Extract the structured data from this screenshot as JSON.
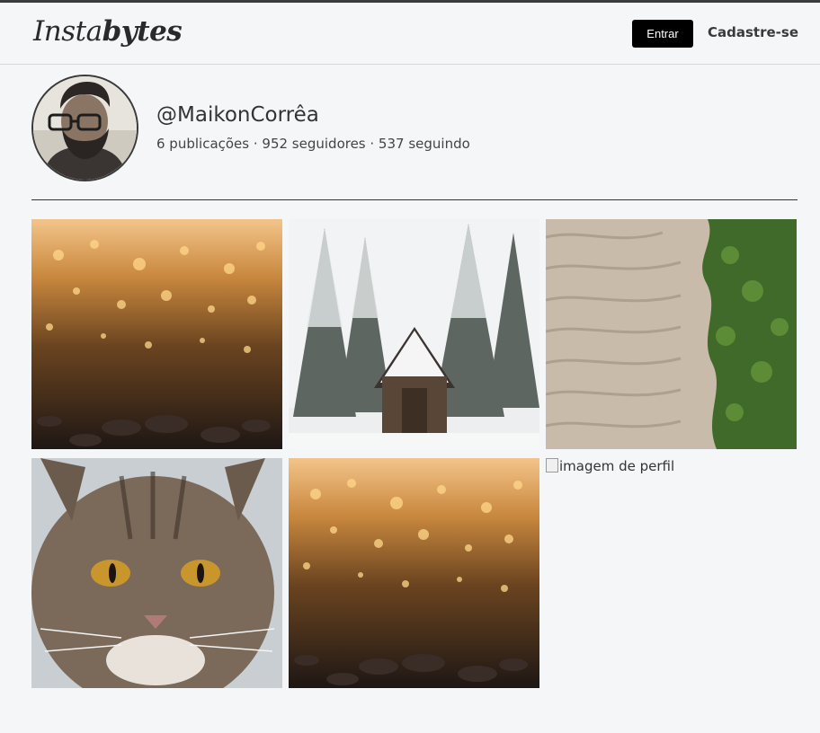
{
  "header": {
    "logo_regular": "Insta",
    "logo_bold": "bytes",
    "login_label": "Entrar",
    "signup_label": "Cadastre-se"
  },
  "profile": {
    "username": "@MaikonCorrêa",
    "stats": "6 publicações · 952 seguidores · 537 seguindo"
  },
  "posts": [
    {
      "subject": "golden bokeh pebbles"
    },
    {
      "subject": "snowy forest cabin"
    },
    {
      "subject": "sand ripples with greenery"
    },
    {
      "subject": "tabby cat close-up"
    },
    {
      "subject": "golden bokeh pebbles"
    },
    {
      "broken_alt": "imagem de perfil"
    }
  ],
  "colors": {
    "background": "#f5f6f8",
    "login_button": "#000000",
    "text": "#333333"
  }
}
